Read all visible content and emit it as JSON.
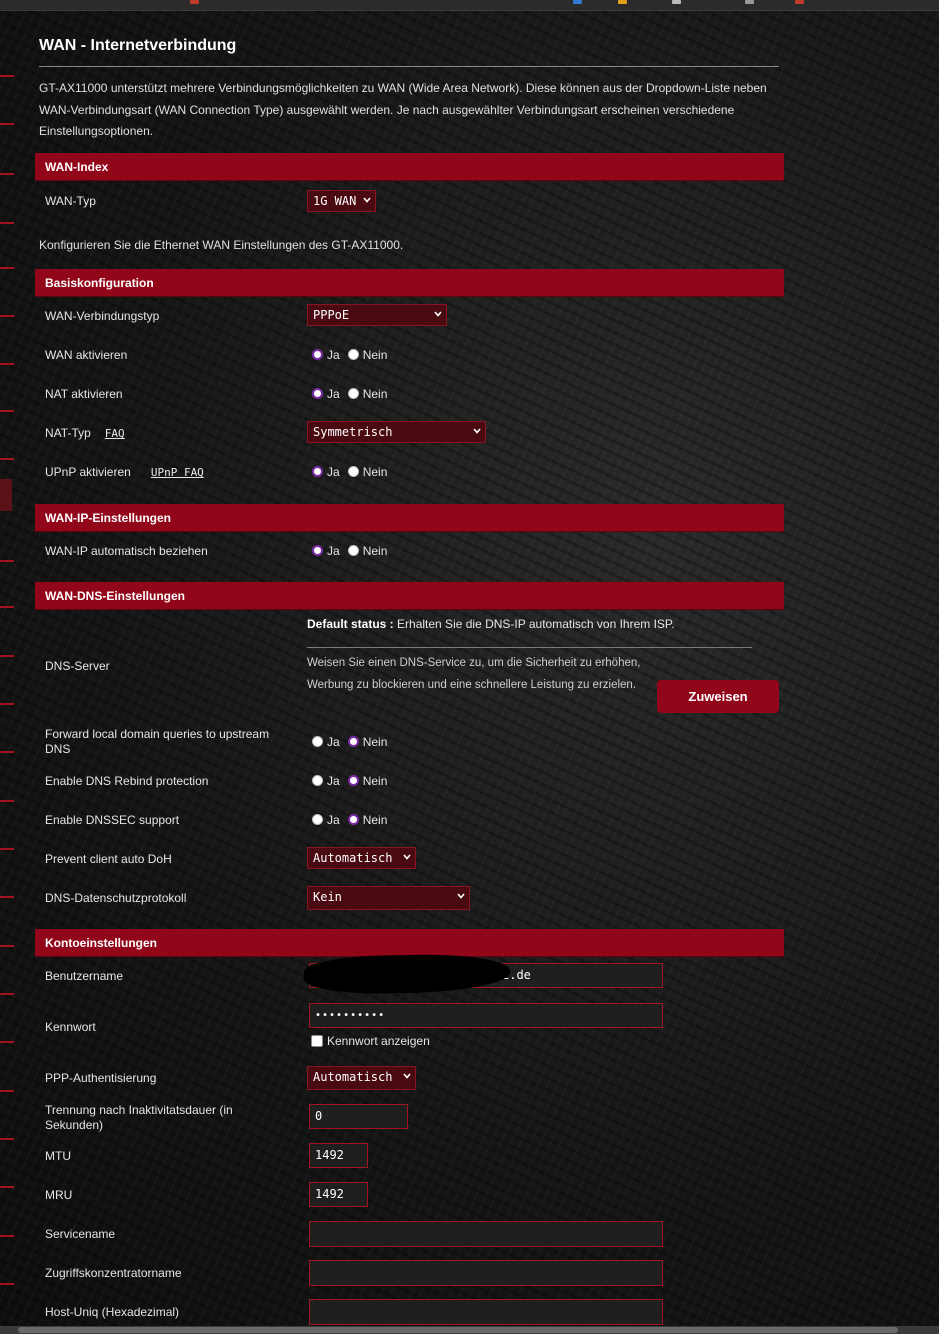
{
  "page": {
    "title": "WAN - Internetverbindung",
    "intro": "GT-AX11000 unterstützt mehrere Verbindungsmöglichkeiten zu WAN (Wide Area Network). Diese können aus der Dropdown-Liste neben WAN-Verbindungsart (WAN Connection Type) ausgewählt werden. Je nach ausgewählter Verbindungsart erscheinen verschiedene Einstellungsoptionen.",
    "ethernet_note": "Konfigurieren Sie die Ethernet WAN Einstellungen des GT-AX11000."
  },
  "wan_index": {
    "header": "WAN-Index",
    "wan_type_label": "WAN-Typ",
    "wan_type_value": "1G WAN"
  },
  "basic": {
    "header": "Basiskonfiguration",
    "conn_type_label": "WAN-Verbindungstyp",
    "conn_type_value": "PPPoE",
    "wan_enable_label": "WAN aktivieren",
    "nat_enable_label": "NAT aktivieren",
    "nat_type_label": "NAT-Typ",
    "nat_type_faq": "FAQ",
    "nat_type_value": "Symmetrisch",
    "upnp_label": "UPnP aktivieren",
    "upnp_faq": "UPnP FAQ"
  },
  "wan_ip": {
    "header": "WAN-IP-Einstellungen",
    "auto_label": "WAN-IP automatisch beziehen"
  },
  "wan_dns": {
    "header": "WAN-DNS-Einstellungen",
    "default_status_key": "Default status :",
    "default_status_value": "Erhalten Sie die DNS-IP automatisch von Ihrem ISP.",
    "dns_server_label": "DNS-Server",
    "dns_desc": "Weisen Sie einen DNS-Service zu, um die Sicherheit zu erhöhen, Werbung zu blockieren und eine schnellere Leistung zu erzielen.",
    "assign_button": "Zuweisen",
    "forward_label": "Forward local domain queries to upstream DNS",
    "rebind_label": "Enable DNS Rebind protection",
    "dnssec_label": "Enable DNSSEC support",
    "doh_label": "Prevent client auto DoH",
    "doh_value": "Automatisch",
    "privacy_label": "DNS-Datenschutzprotokoll",
    "privacy_value": "Kein"
  },
  "radio": {
    "yes": "Ja",
    "no": "Nein"
  },
  "account": {
    "header": "Kontoeinstellungen",
    "username_label": "Benutzername",
    "username_value": "2.de",
    "password_label": "Kennwort",
    "password_value": "••••••••••",
    "show_password_label": "Kennwort anzeigen",
    "ppp_auth_label": "PPP-Authentisierung",
    "ppp_auth_value": "Automatisch",
    "idle_label": "Trennung nach Inaktivitatsdauer (in Sekunden)",
    "idle_value": "0",
    "mtu_label": "MTU",
    "mtu_value": "1492",
    "mru_label": "MRU",
    "mru_value": "1492",
    "service_label": "Servicename",
    "service_value": "",
    "concentrator_label": "Zugriffskonzentratorname",
    "concentrator_value": "",
    "hostuniq_label": "Host-Uniq (Hexadezimal)",
    "hostuniq_value": ""
  },
  "colors": {
    "accent": "#92061a",
    "radio_checked": "#7a2ca8",
    "select_bg": "#4a0a12"
  }
}
